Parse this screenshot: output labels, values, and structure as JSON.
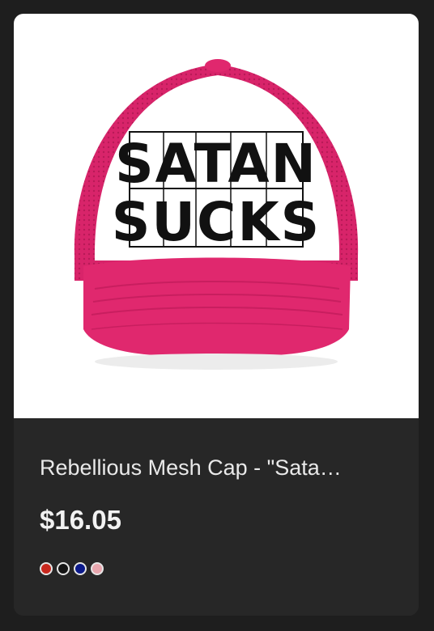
{
  "product": {
    "image_text_line1": "SATAN",
    "image_text_line2": "SUCKS",
    "title": "Rebellious Mesh Cap - \"Sata…",
    "price": "$16.05",
    "swatches": [
      {
        "name": "red",
        "color": "#c8281e"
      },
      {
        "name": "black",
        "color": "#151515"
      },
      {
        "name": "navy",
        "color": "#0c1a8a"
      },
      {
        "name": "pink",
        "color": "#e8a6ae"
      }
    ],
    "colors": {
      "cap_pink": "#e0286e",
      "cap_pink_dark": "#c81e5f",
      "cap_front": "#ffffff",
      "print_ink": "#111111"
    }
  }
}
